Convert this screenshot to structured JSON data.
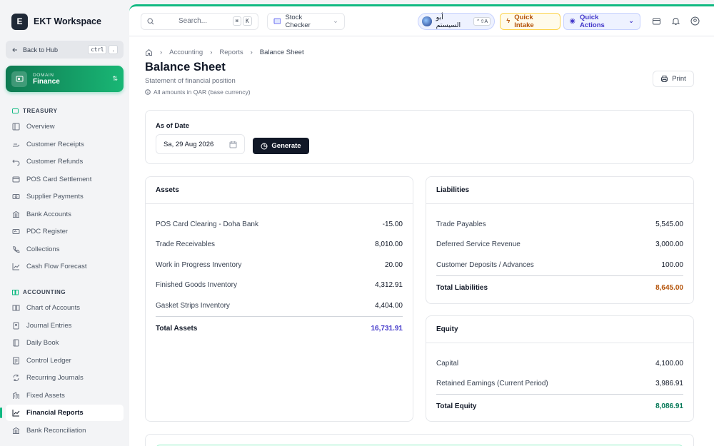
{
  "app": {
    "logo_letter": "E",
    "name": "EKT Workspace"
  },
  "sidebar": {
    "back_label": "Back to Hub",
    "back_kbd": [
      "ctrl",
      "."
    ],
    "domain": {
      "label": "DOMAIN",
      "value": "Finance"
    },
    "sections": [
      {
        "title": "TREASURY",
        "items": [
          "Overview",
          "Customer Receipts",
          "Customer Refunds",
          "POS Card Settlement",
          "Supplier Payments",
          "Bank Accounts",
          "PDC Register",
          "Collections",
          "Cash Flow Forecast"
        ]
      },
      {
        "title": "ACCOUNTING",
        "items": [
          "Chart of Accounts",
          "Journal Entries",
          "Daily Book",
          "Control Ledger",
          "Recurring Journals",
          "Fixed Assets",
          "Financial Reports",
          "Bank Reconciliation"
        ]
      }
    ],
    "active_item": "Financial Reports"
  },
  "topbar": {
    "search_placeholder": "Search...",
    "search_kbd": [
      "⌘",
      "K"
    ],
    "app_switcher": "Stock Checker",
    "user_name": "أبو السيستم",
    "user_kbd": "⌃⇧A",
    "quick_intake": "Quick Intake",
    "quick_actions": "Quick Actions"
  },
  "breadcrumb": [
    "Accounting",
    "Reports",
    "Balance Sheet"
  ],
  "page": {
    "title": "Balance Sheet",
    "subtitle": "Statement of financial position",
    "note": "All amounts in QAR (base currency)",
    "print": "Print"
  },
  "filter": {
    "label": "As of Date",
    "date": "Sa, 29 Aug 2026",
    "generate": "Generate"
  },
  "assets": {
    "title": "Assets",
    "rows": [
      {
        "name": "POS Card Clearing - Doha Bank",
        "amount": "-15.00"
      },
      {
        "name": "Trade Receivables",
        "amount": "8,010.00"
      },
      {
        "name": "Work in Progress Inventory",
        "amount": "20.00"
      },
      {
        "name": "Finished Goods Inventory",
        "amount": "4,312.91"
      },
      {
        "name": "Gasket Strips Inventory",
        "amount": "4,404.00"
      }
    ],
    "total_label": "Total Assets",
    "total": "16,731.91"
  },
  "liabilities": {
    "title": "Liabilities",
    "rows": [
      {
        "name": "Trade Payables",
        "amount": "5,545.00"
      },
      {
        "name": "Deferred Service Revenue",
        "amount": "3,000.00"
      },
      {
        "name": "Customer Deposits / Advances",
        "amount": "100.00"
      }
    ],
    "total_label": "Total Liabilities",
    "total": "8,645.00"
  },
  "equity": {
    "title": "Equity",
    "rows": [
      {
        "name": "Capital",
        "amount": "4,100.00"
      },
      {
        "name": "Retained Earnings (Current Period)",
        "amount": "3,986.91"
      }
    ],
    "total_label": "Total Equity",
    "total": "8,086.91"
  },
  "colors": {
    "accent": "#10b981",
    "assets_total": "#4338ca",
    "liabilities_total": "#b45309",
    "equity_total": "#047857"
  }
}
